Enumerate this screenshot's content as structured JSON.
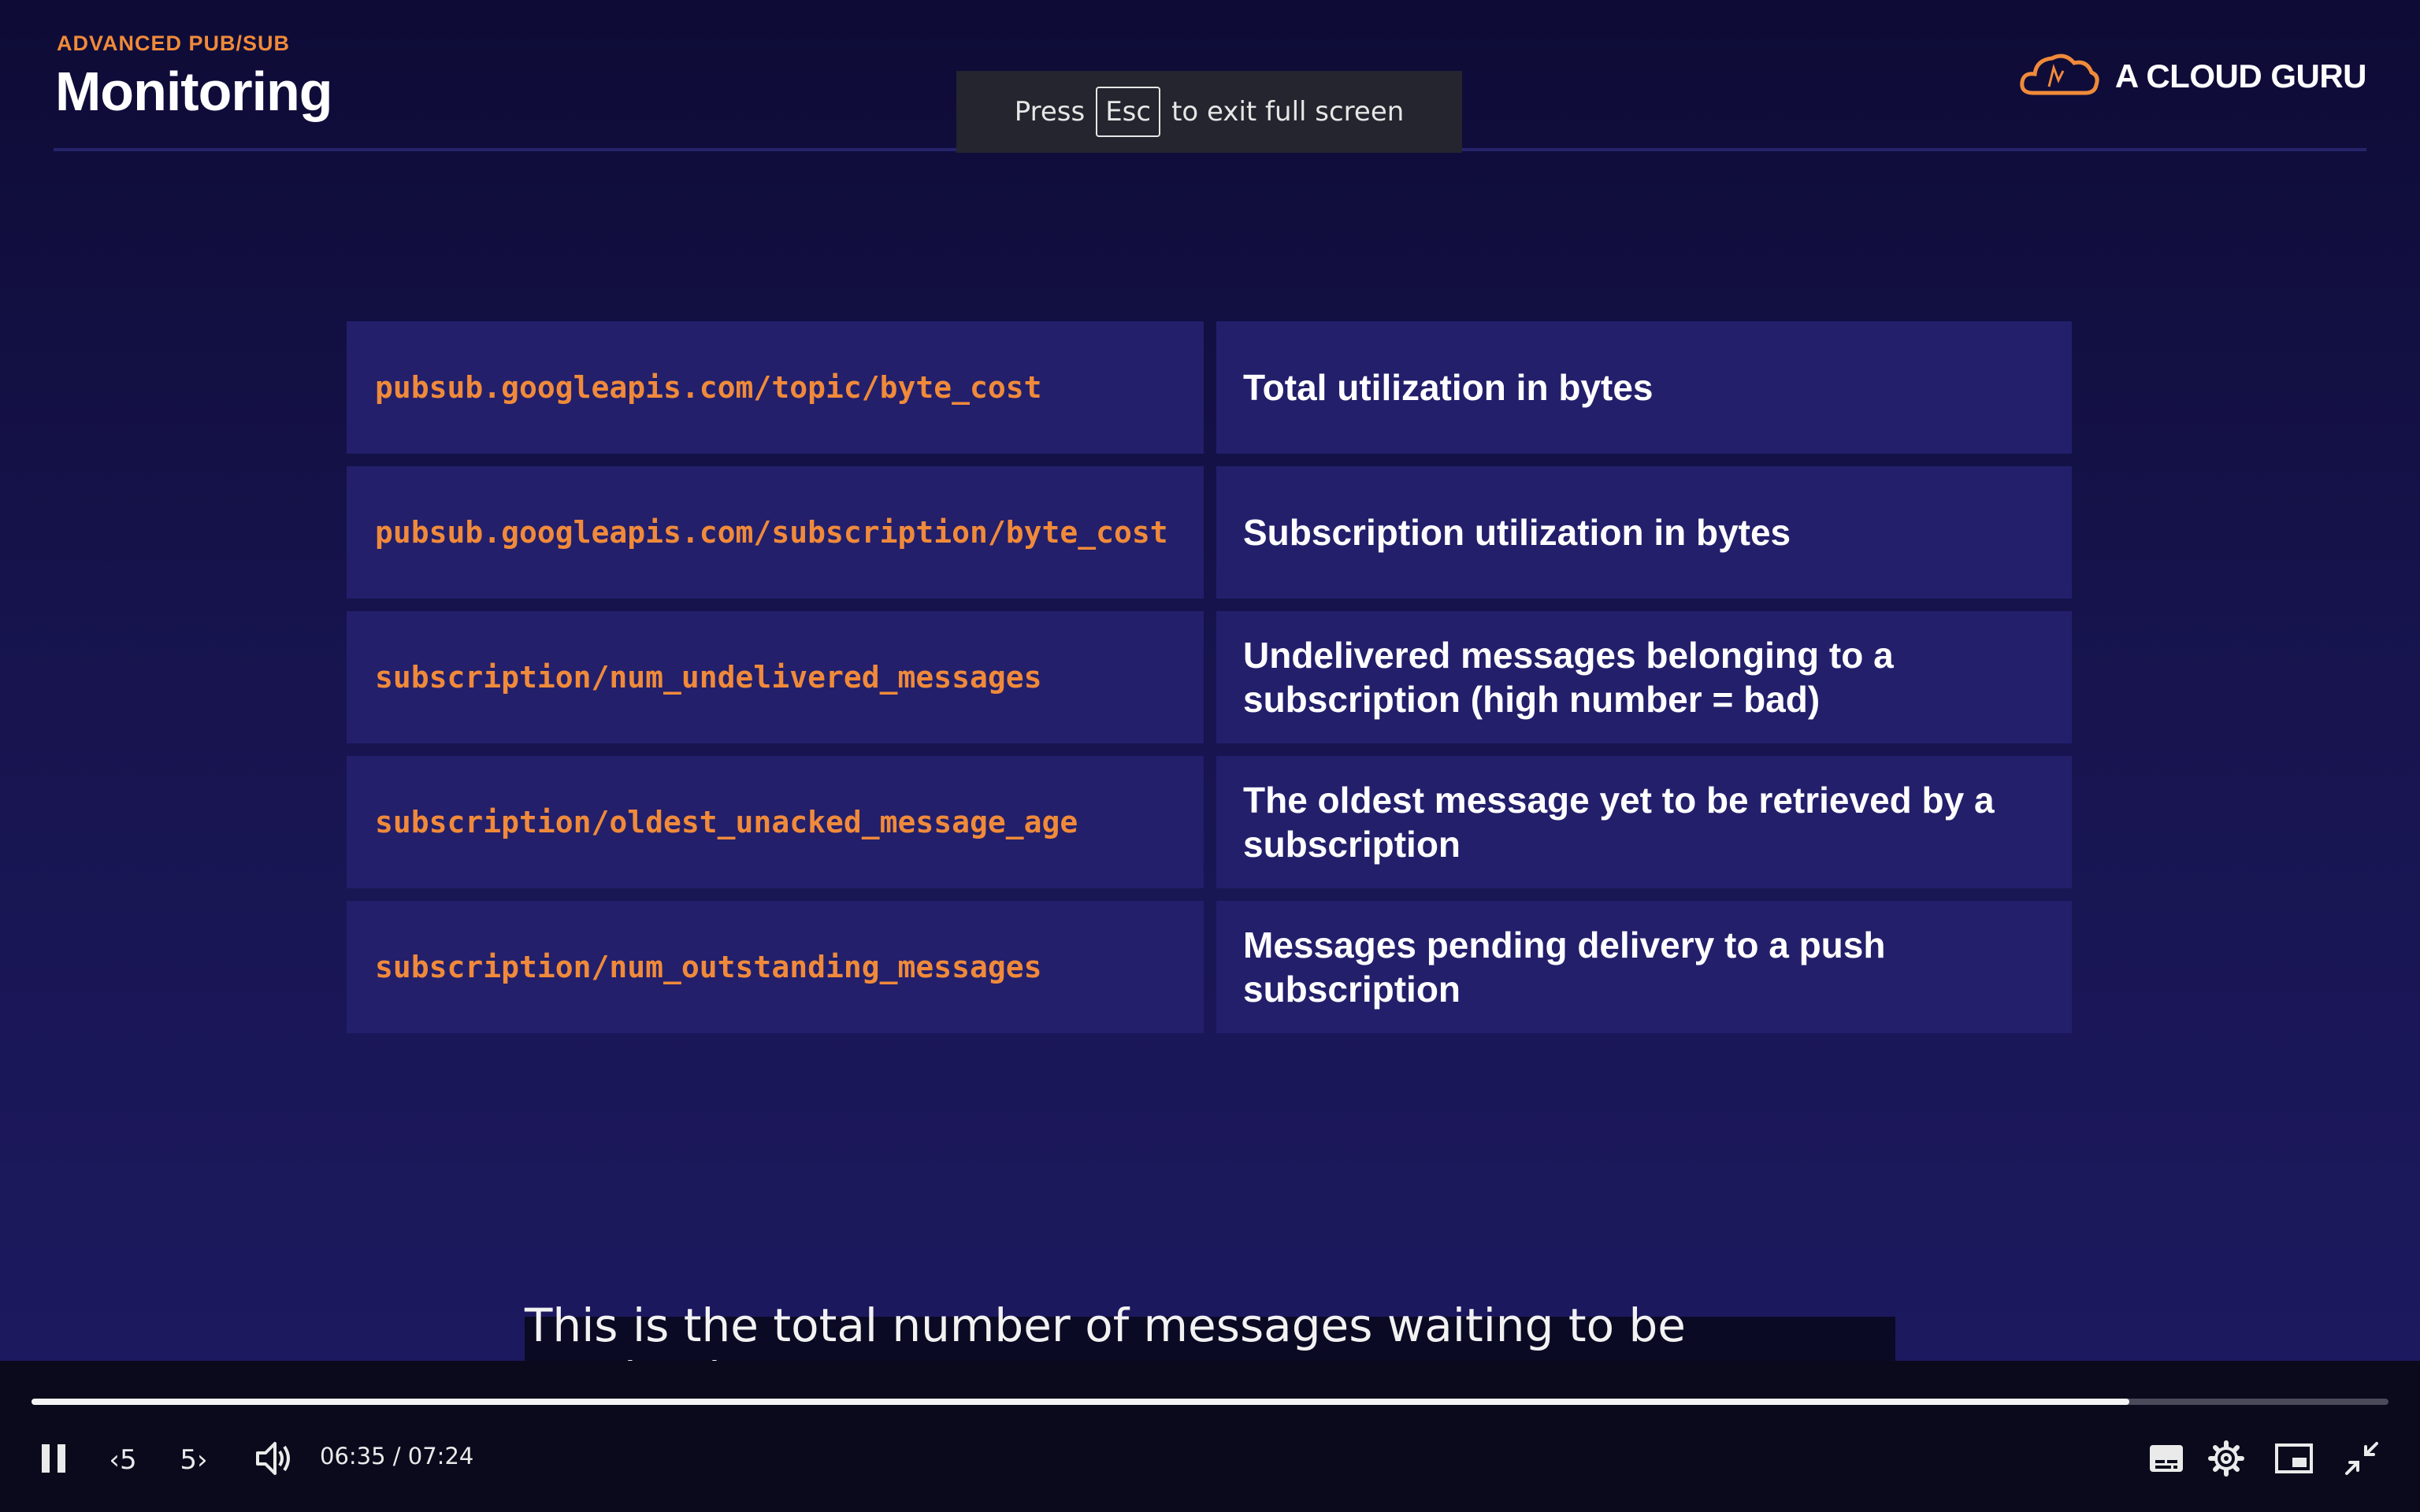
{
  "slide": {
    "eyebrow": "ADVANCED PUB/SUB",
    "title": "Monitoring",
    "brand": "A CLOUD GURU",
    "accent_color": "#f08a3a",
    "rows": [
      {
        "metric": "pubsub.googleapis.com/topic/byte_cost",
        "description": "Total utilization in bytes"
      },
      {
        "metric": "pubsub.googleapis.com/subscription/byte_cost",
        "description": "Subscription utilization in bytes"
      },
      {
        "metric": "subscription/num_undelivered_messages",
        "description": "Undelivered messages belonging to a subscription (high number = bad)"
      },
      {
        "metric": "subscription/oldest_unacked_message_age",
        "description": "The oldest message yet to be retrieved by a subscription"
      },
      {
        "metric": "subscription/num_outstanding_messages",
        "description": "Messages pending delivery to a push subscription"
      }
    ]
  },
  "fullscreen_banner": {
    "prefix": "Press",
    "key": "Esc",
    "suffix": "to exit full screen"
  },
  "caption": "This is the total number of messages waiting to be received",
  "player": {
    "time": "06:35 / 07:24",
    "progress_fraction": 0.89,
    "rewind_label": "5",
    "forward_label": "5",
    "icons": [
      "pause-icon",
      "rewind-5-icon",
      "forward-5-icon",
      "volume-icon",
      "subtitles-icon",
      "settings-icon",
      "picture-in-picture-icon",
      "exit-fullscreen-icon"
    ]
  }
}
